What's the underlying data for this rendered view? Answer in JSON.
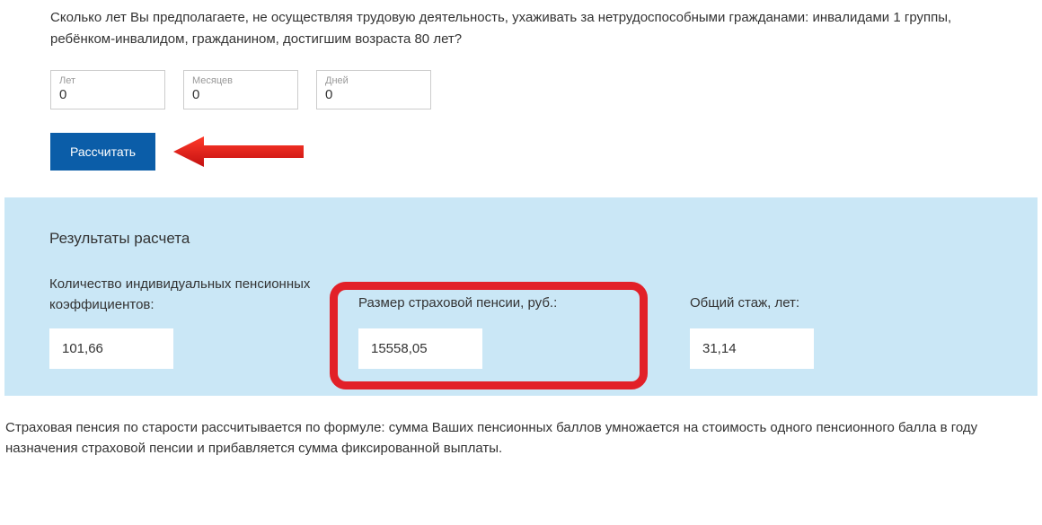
{
  "question": "Сколько лет Вы предполагаете, не осуществляя трудовую деятельность, ухаживать за нетрудоспособными гражданами: инвалидами 1 группы, ребёнком-инвалидом, гражданином, достигшим возраста 80 лет?",
  "inputs": {
    "years": {
      "label": "Лет",
      "value": "0"
    },
    "months": {
      "label": "Месяцев",
      "value": "0"
    },
    "days": {
      "label": "Дней",
      "value": "0"
    }
  },
  "button": {
    "calculate": "Рассчитать"
  },
  "results": {
    "title": "Результаты расчета",
    "coefficients": {
      "label": "Количество индивидуальных пенсионных коэффициентов:",
      "value": "101,66"
    },
    "pension_amount": {
      "label": "Размер страховой пенсии, руб.:",
      "value": "15558,05"
    },
    "total_experience": {
      "label": "Общий стаж, лет:",
      "value": "31,14"
    }
  },
  "formula": "Страховая пенсия по старости рассчитывается по формуле: сумма Ваших пенсионных баллов умножается на стоимость одного пенсионного балла в году назначения страховой пенсии и прибавляется сумма фиксированной выплаты."
}
